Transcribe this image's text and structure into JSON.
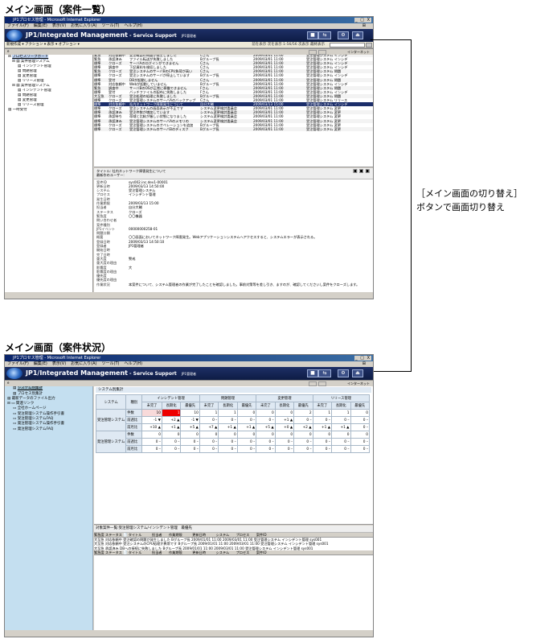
{
  "sections": {
    "top_title": "メイン画面（案件一覧）",
    "bottom_title": "メイン画面（案件状況）"
  },
  "callout": {
    "line1": "［メイン画面の切り替え］",
    "line2": "ボタンで画面切り替え"
  },
  "window": {
    "title": "JP1プロセス管理 - Microsoft Internet Explorer",
    "controls": "_ □ X",
    "menu": [
      "ファイル(F)",
      "編集(E)",
      "表示(V)",
      "お気に入り(A)",
      "ツール(T)",
      "ヘルプ(H)"
    ],
    "brand": "JP1/Integrated Management",
    "brand_suffix": " - Service Support",
    "user": "JP1管理者",
    "status_zone": "インターネット"
  },
  "top_screen": {
    "toolbar": "新規作成 ▾  アクション ▾  表示 ▾  オプション ▾",
    "pager": "前を表示  次を表示  1-56/56  次表示  最終表示",
    "tree_header": "プロセスワークボード一覧",
    "tree": [
      "プロセスワークボード",
      "案件管理システム",
      "インシデント管理",
      "問題管理",
      "変更管理",
      "リリース管理",
      "案件管理システム",
      "インシデント管理",
      "問題管理",
      "変更管理",
      "リリース管理",
      "一時受付"
    ],
    "grid_header": "案件一覧 (プロセスワークボード",
    "grid_rows": [
      [
        "緊急",
        "対応依頼中",
        "受注確認の問題が発生しました",
        "Cさん",
        "2009/03/01 11:00",
        "受注管理システム インシデ"
      ],
      [
        "緊急",
        "承認済み",
        "ファイル転送が失敗しました",
        "Bグループ長",
        "2009/03/01 11:00",
        "受注管理システム インシデ"
      ],
      [
        "標準",
        "クローズ",
        "サーバAのログインができません",
        "Cさん",
        "2009/03/01 11:00",
        "受注管理システム インシデ"
      ],
      [
        "標準",
        "調査中",
        "下記資料を検収しました",
        "Cさん",
        "2009/03/01 11:00",
        "受注管理システム インシデ"
      ],
      [
        "緊急",
        "クローズ",
        "受注システムのサーバBのCPU負荷が高い",
        "Cさん",
        "2009/03/01 11:00",
        "受注管理システム 問題"
      ],
      [
        "標準",
        "クローズ",
        "受注システムのサーバが停止しています",
        "Bグループ長",
        "2009/03/01 11:00",
        "受注管理システム インシデ"
      ],
      [
        "標準",
        "受付",
        "DBが起動しません",
        "Cさん",
        "2009/03/01 11:00",
        "受注管理システム 問題"
      ],
      [
        "標準",
        "対応依頼中",
        "Webが起動していません",
        "Bグループ長",
        "2009/03/01 11:00",
        "受注管理システム インシデ"
      ],
      [
        "緊急",
        "調査中",
        "サーバBのOSが正常に稼働できません",
        "Fさん",
        "2009/03/01 11:00",
        "受注管理システム 問題"
      ],
      [
        "標準",
        "受付",
        "バッチファイルの配布に失敗しました",
        "Fさん",
        "2009/03/01 11:00",
        "受注管理システム インシデ"
      ],
      [
        "大至急",
        "クローズ",
        "受注処理の処理に失敗しました",
        "Bグループ長",
        "2009/03/01 11:00",
        "受注管理システム 問題"
      ],
      [
        "標準",
        "クローズ",
        "受注管理システムのサーバAのバックアップ",
        "Cさん",
        "2009/03/01 11:00",
        "受注管理システム リリース"
      ],
      [
        "標準",
        "対応依頼中",
        "社内ネットワーク障害発生について",
        "自分大輔",
        "2009/03/13 15:00",
        "受注管理システム インシデ"
      ],
      [
        "標準",
        "クローズ",
        "受注システムの画面表示が不正です",
        "システム変更検討委員会",
        "2009/03/01 11:00",
        "受注管理システム 変更"
      ],
      [
        "標準",
        "承認済み",
        "受注件数が増加しています",
        "システム変更検討委員会",
        "2009/03/01 11:00",
        "受注管理システム 変更"
      ],
      [
        "標準",
        "承認待ち",
        "帯域と比較が厳しい状態になりました",
        "システム変更検討委員会",
        "2009/03/01 11:00",
        "受注管理システム 変更"
      ],
      [
        "標準",
        "承認済み",
        "受注管理システムのサーバAのメモリの",
        "システム変更検討委員会",
        "2009/03/01 11:00",
        "受注管理システム 変更"
      ],
      [
        "標準",
        "クローズ",
        "受注管理システムのオペレーションを追加",
        "Bグループ長",
        "2009/03/01 11:00",
        "受注管理システム 変更"
      ],
      [
        "標準",
        "クローズ",
        "受注管理システムのサーバBのディスク",
        "Bグループ長",
        "2009/03/01 11:00",
        "受注管理システム 変更"
      ]
    ],
    "detail_title": "タイトル: 社内ネットワーク障害発生について",
    "detail_subtitle": "最新作のユーザー:",
    "detail_fields": [
      [
        "案件ID",
        "sys002.inc.dev1-00001"
      ],
      [
        "更新日時",
        "2009/03/13 14:50:00"
      ],
      [
        "システム",
        "受注管理システム"
      ],
      [
        "プロセス",
        "インシデント管理"
      ],
      [
        "発生日時",
        ""
      ],
      [
        "作業期限",
        "2009/03/13 15:00"
      ],
      [
        "担当者",
        "自分大輔"
      ],
      [
        "ステータス",
        "クローズ"
      ],
      [
        "緊急度",
        "〇〇機器"
      ],
      [
        "問い合わせ者",
        ""
      ],
      [
        "案件種別",
        ""
      ],
      [
        "JP1イベント",
        "00000000258-01"
      ],
      [
        "問題分類",
        ""
      ],
      [
        "概要",
        "〇〇画面においてネットワーク障害発生。Webアプリケーションシステムへアクセスすると、システムエラーが表示される。"
      ],
      [
        "登録日時",
        "2009/03/13 14:50:10"
      ],
      [
        "登録者",
        "JP1管理者"
      ],
      [
        "開始日時",
        ""
      ],
      [
        "完了日時",
        ""
      ],
      [
        "重大度",
        "警戒"
      ],
      [
        "重大度の理由",
        ""
      ],
      [
        "影響度",
        "大"
      ],
      [
        "影響度の理由",
        ""
      ],
      [
        "優先度",
        ""
      ],
      [
        "優先度の理由",
        ""
      ],
      [
        "作業状況",
        "本案件について、システム管理者の作業が完了したことを確認しました。事前対策等を差し引き、ますのが、確認してくださいし案件をクローズします。"
      ]
    ]
  },
  "bottom_screen": {
    "side": [
      "案件状況",
      "システム別集計",
      "プロセス別集計",
      "最新データのファイル出力",
      "関連リンク",
      "全社ホームページ",
      "受注管理システム操作手引書",
      "受注管理システムFAQ",
      "発注管理システム操作手引書",
      "発注管理システムFAQ"
    ],
    "status_tab": "状況確認",
    "status_sub": "システム別集計",
    "table": {
      "col_system": "システム",
      "col_kind": "種別",
      "groups": [
        "インシデント管理",
        "問題管理",
        "変更管理",
        "リリース管理"
      ],
      "subcols": [
        "未完了",
        "長期化",
        "最優先"
      ],
      "rows": [
        {
          "system": "受注管理システム",
          "kind": "件数",
          "cells": [
            "10",
            "1",
            "10",
            "1",
            "1",
            "0",
            "0",
            "0",
            "2",
            "1",
            "1",
            "0"
          ]
        },
        {
          "system": "",
          "kind": "前週比",
          "cells": [
            "-1 ▼",
            "+2 ▲",
            "-1 ▼",
            "0 –",
            "0 –",
            "0 –",
            "0 –",
            "+1 ▲",
            "0 –",
            "0 –",
            "0 –",
            "0 –"
          ]
        },
        {
          "system": "",
          "kind": "前月比",
          "cells": [
            "+10 ▲",
            "+1 ▲",
            "+5 ▲",
            "+7 ▲",
            "+1 ▲",
            "+1 ▲",
            "+5 ▲",
            "+0 ▲",
            "+2 ▲",
            "+1 ▲",
            "+1 ▲",
            "0 –"
          ]
        },
        {
          "system": "発注管理システム",
          "kind": "件数",
          "cells": [
            "0",
            "0",
            "0",
            "0",
            "0",
            "0",
            "0",
            "0",
            "0",
            "0",
            "0",
            "0"
          ]
        },
        {
          "system": "",
          "kind": "前週比",
          "cells": [
            "0 –",
            "0 –",
            "0 –",
            "0 –",
            "0 –",
            "0 –",
            "0 –",
            "0 –",
            "0 –",
            "0 –",
            "0 –",
            "0 –"
          ]
        },
        {
          "system": "",
          "kind": "前月比",
          "cells": [
            "0 –",
            "0 –",
            "0 –",
            "0 –",
            "0 –",
            "0 –",
            "0 –",
            "0 –",
            "0 –",
            "0 –",
            "0 –",
            "0 –"
          ]
        }
      ]
    },
    "list_title": "対象案件一覧:受注管理システム/インシデント管理　最優先",
    "list_header": "緊急度 ステータス 📄 タイトル　　　担当者　　作業期限　　　更新日時　　　システム　　プロセス　　案件ID",
    "list_rows": [
      "大至急 対応依頼中 受注確認の問題が発生しました  Bグループ長 2009/01/01 11:00 2009/03/01 11:00 受注管理システム インシデント管理 sys001",
      "大至急 対応依頼中 受注システムのCPU処理が異常です  Bグループ長 2009/01/01 11:00 2009/03/01 11:00 受注管理システム インシデント管理 sys001",
      "大至急 承認済み DBへの接続に失敗しました  Bグループ長 2009/01/01 11:00 2009/03/01 11:00 受注管理システム インシデント管理 sys001"
    ],
    "list_footer": "緊急度 ステータス 📄 タイトル　　　担当者　　作業期限　　　更新日時　　　システム　　プロセス　　案件ID"
  }
}
